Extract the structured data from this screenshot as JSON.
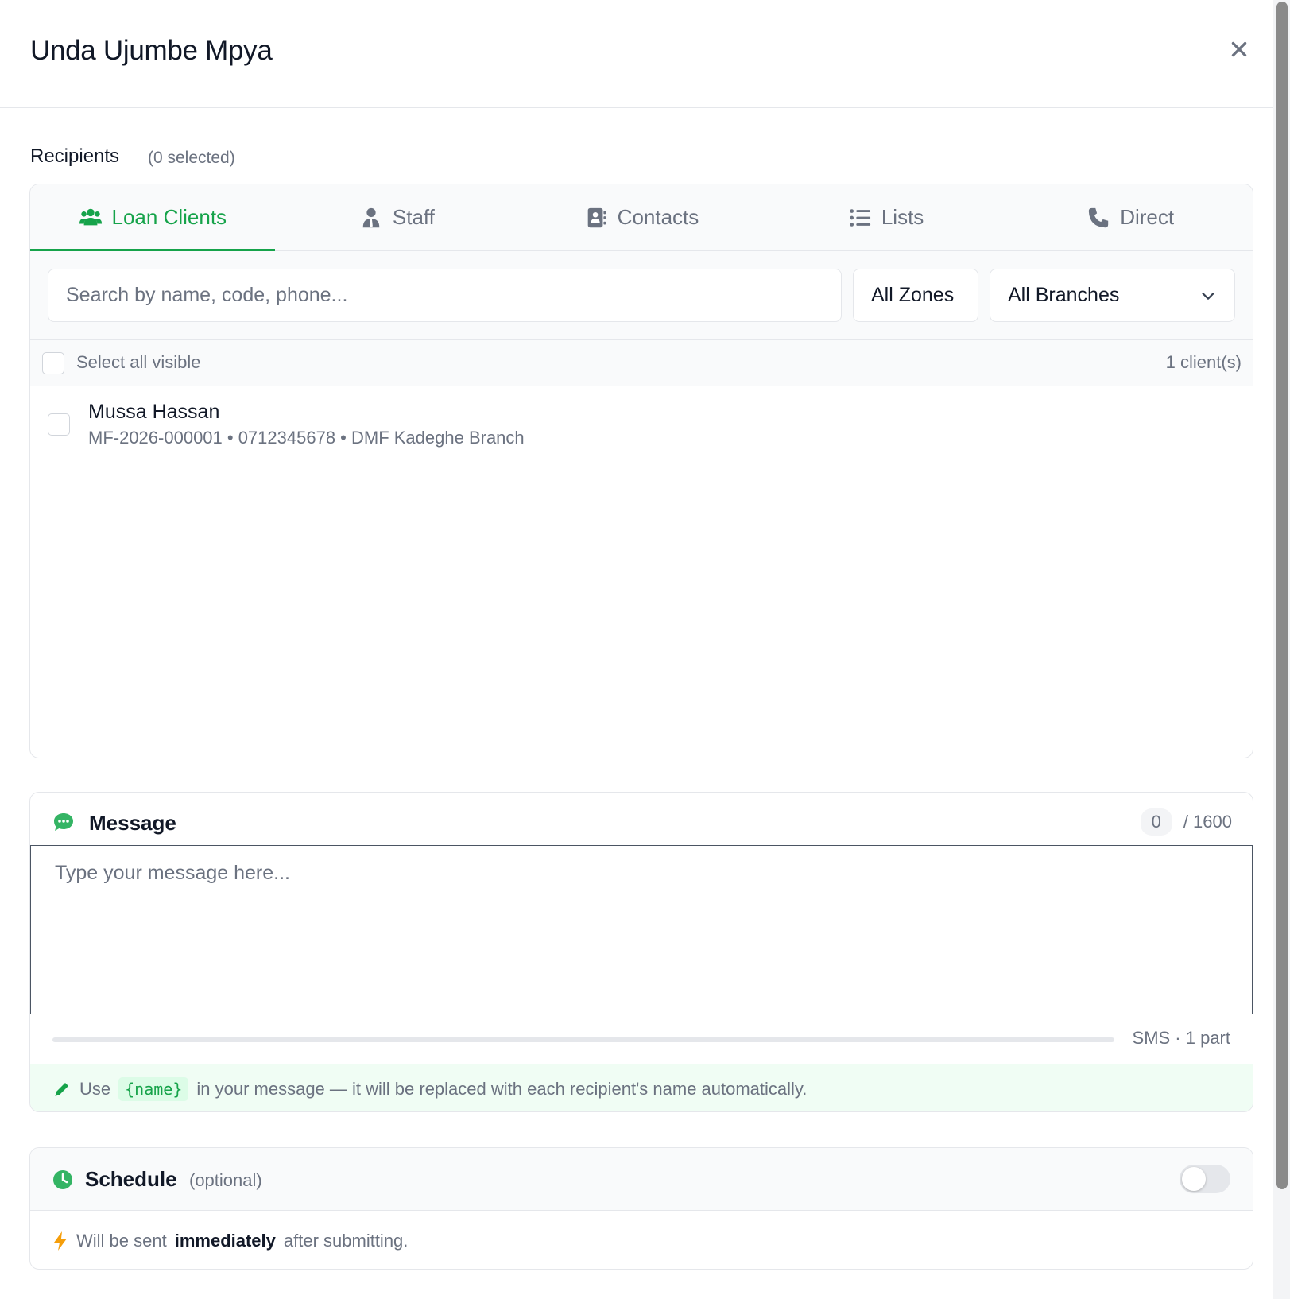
{
  "modal": {
    "title": "Unda Ujumbe Mpya"
  },
  "recipients": {
    "label": "Recipients",
    "selected_count": "(0 selected)",
    "tabs": [
      {
        "label": "Loan Clients",
        "icon": "users-icon",
        "active": true
      },
      {
        "label": "Staff",
        "icon": "user-tie-icon",
        "active": false
      },
      {
        "label": "Contacts",
        "icon": "address-book-icon",
        "active": false
      },
      {
        "label": "Lists",
        "icon": "list-icon",
        "active": false
      },
      {
        "label": "Direct",
        "icon": "phone-icon",
        "active": false
      }
    ],
    "search_placeholder": "Search by name, code, phone...",
    "zone_filter": "All Zones",
    "branch_filter": "All Branches",
    "select_all_label": "Select all visible",
    "client_count": "1 client(s)",
    "clients": [
      {
        "name": "Mussa Hassan",
        "meta": "MF-2026-000001 • 0712345678 • DMF Kadeghe Branch"
      }
    ]
  },
  "message": {
    "title": "Message",
    "char_count": "0",
    "char_limit": "/ 1600",
    "placeholder": "Type your message here...",
    "sms_info": "SMS · 1 part",
    "length_used_fraction": 0,
    "tip_prefix": "Use",
    "tip_token": "{name}",
    "tip_suffix": "in your message — it will be replaced with each recipient's name automatically."
  },
  "schedule": {
    "title": "Schedule",
    "optional": "(optional)",
    "enabled": false,
    "note_prefix": "Will be sent",
    "note_bold": "immediately",
    "note_suffix": "after submitting."
  },
  "colors": {
    "accent": "#16a34a",
    "muted": "#6b7280",
    "border": "#e5e7eb",
    "warning": "#f59e0b"
  }
}
